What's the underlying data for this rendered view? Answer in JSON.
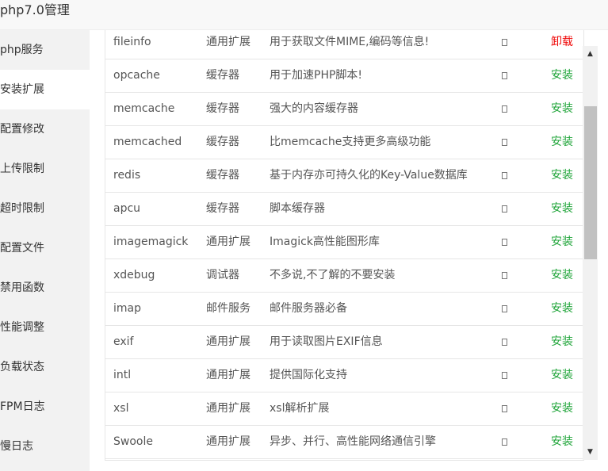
{
  "window": {
    "title": "php7.0管理"
  },
  "sidebar": {
    "items": [
      {
        "label": "php服务"
      },
      {
        "label": "安装扩展",
        "active": true
      },
      {
        "label": "配置修改"
      },
      {
        "label": "上传限制"
      },
      {
        "label": "超时限制"
      },
      {
        "label": "配置文件"
      },
      {
        "label": "禁用函数"
      },
      {
        "label": "性能调整"
      },
      {
        "label": "负载状态"
      },
      {
        "label": "FPM日志"
      },
      {
        "label": "慢日志"
      }
    ]
  },
  "colors": {
    "install": "#20a53a",
    "uninstall": "#ef0808"
  },
  "extensions": {
    "rows": [
      {
        "name": "fileinfo",
        "type": "通用扩展",
        "desc": "用于获取文件MIME,编码等信息!",
        "action": "卸载",
        "status_color": "#ef0808"
      },
      {
        "name": "opcache",
        "type": "缓存器",
        "desc": "用于加速PHP脚本!",
        "action": "安装",
        "status_color": "#20a53a"
      },
      {
        "name": "memcache",
        "type": "缓存器",
        "desc": "强大的内容缓存器",
        "action": "安装",
        "status_color": "#20a53a"
      },
      {
        "name": "memcached",
        "type": "缓存器",
        "desc": "比memcache支持更多高级功能",
        "action": "安装",
        "status_color": "#20a53a"
      },
      {
        "name": "redis",
        "type": "缓存器",
        "desc": "基于内存亦可持久化的Key-Value数据库",
        "action": "安装",
        "status_color": "#20a53a"
      },
      {
        "name": "apcu",
        "type": "缓存器",
        "desc": "脚本缓存器",
        "action": "安装",
        "status_color": "#20a53a"
      },
      {
        "name": "imagemagick",
        "type": "通用扩展",
        "desc": "Imagick高性能图形库",
        "action": "安装",
        "status_color": "#20a53a"
      },
      {
        "name": "xdebug",
        "type": "调试器",
        "desc": "不多说,不了解的不要安装",
        "action": "安装",
        "status_color": "#20a53a"
      },
      {
        "name": "imap",
        "type": "邮件服务",
        "desc": "邮件服务器必备",
        "action": "安装",
        "status_color": "#20a53a"
      },
      {
        "name": "exif",
        "type": "通用扩展",
        "desc": "用于读取图片EXIF信息",
        "action": "安装",
        "status_color": "#20a53a"
      },
      {
        "name": "intl",
        "type": "通用扩展",
        "desc": "提供国际化支持",
        "action": "安装",
        "status_color": "#20a53a"
      },
      {
        "name": "xsl",
        "type": "通用扩展",
        "desc": "xsl解析扩展",
        "action": "安装",
        "status_color": "#20a53a"
      },
      {
        "name": "Swoole",
        "type": "通用扩展",
        "desc": "异步、并行、高性能网络通信引擎",
        "action": "安装",
        "status_color": "#20a53a"
      }
    ]
  },
  "scrollbar": {
    "up_icon": "▲",
    "down_icon": "▼"
  }
}
